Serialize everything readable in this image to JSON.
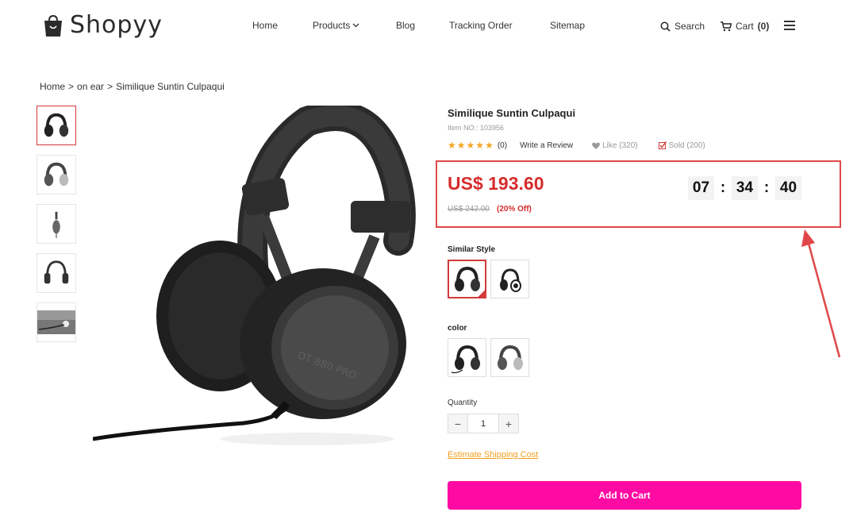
{
  "header": {
    "logo_text": "Shopyy",
    "nav": {
      "home": "Home",
      "products": "Products",
      "blog": "Blog",
      "tracking": "Tracking Order",
      "sitemap": "Sitemap"
    },
    "search_label": "Search",
    "cart_label": "Cart",
    "cart_count": "(0)"
  },
  "breadcrumb": [
    "Home",
    ">",
    "on ear",
    ">",
    "Similique Suntin Culpaqui"
  ],
  "product": {
    "title": "Similique Suntin Culpaqui",
    "item_no": "Item NO.: 103956",
    "rating": 5,
    "review_count": "(0)",
    "write_review": "Write a Review",
    "like": "Like (320)",
    "sold": "Sold (200)",
    "price": "US$ 193.60",
    "old_price": "US$ 242.00",
    "discount": "(20% Off)",
    "countdown": {
      "hours": "07",
      "minutes": "34",
      "seconds": "40",
      "sep": ":"
    }
  },
  "similar_style_label": "Similar Style",
  "color_label": "color",
  "quantity": {
    "label": "Quantity",
    "value": "1",
    "minus": "−",
    "plus": "+"
  },
  "shipping_link": "Estimate Shipping Cost",
  "add_to_cart": "Add to Cart",
  "colors": {
    "accent": "#ff0aa3",
    "price": "#d62c2c",
    "highlight_border": "#e04848",
    "link": "#f0a020",
    "star": "#f5a623"
  }
}
